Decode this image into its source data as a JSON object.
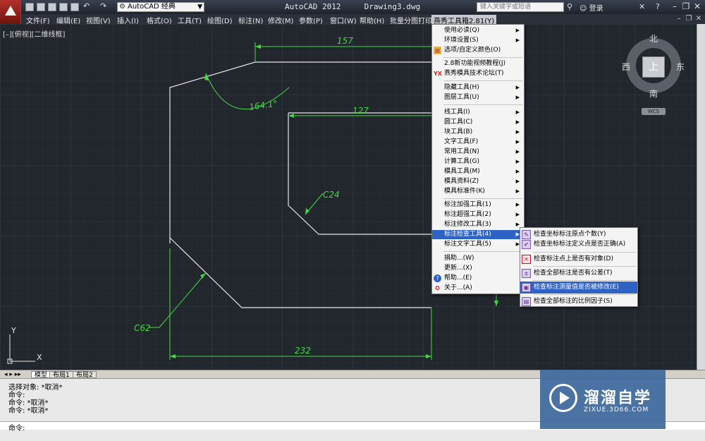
{
  "titlebar": {
    "app_title": "AutoCAD 2012",
    "document": "Drawing3.dwg",
    "workspace": "AutoCAD 经典",
    "search_placeholder": "键入关键字或短语",
    "login": "登录",
    "minimize": "–",
    "restore": "❐",
    "close": "✕"
  },
  "menubar": [
    {
      "label": "文件(F)"
    },
    {
      "label": "编辑(E)"
    },
    {
      "label": "视图(V)"
    },
    {
      "label": "插入(I)"
    },
    {
      "label": "格式(O)"
    },
    {
      "label": "工具(T)"
    },
    {
      "label": "绘图(D)"
    },
    {
      "label": "标注(N)"
    },
    {
      "label": "修改(M)"
    },
    {
      "label": "参数(P)"
    },
    {
      "label": "窗口(W)"
    },
    {
      "label": "帮助(H)"
    },
    {
      "label": "批量分图打印"
    },
    {
      "label": "燕秀工具箱2.81(Y)"
    }
  ],
  "viewport": {
    "label": "[–][俯视][二维线框]"
  },
  "viewcube": {
    "north": "北",
    "south": "南",
    "east": "东",
    "west": "西",
    "top": "上",
    "wcs": "WCS"
  },
  "drawing": {
    "dims": {
      "d157": "157",
      "d127": "127",
      "angle": "164.1°",
      "c24": "C24",
      "c62": "C62",
      "d232": "232"
    },
    "ucs": {
      "x": "X",
      "y": "Y"
    }
  },
  "menu": {
    "items": [
      {
        "label": "使用必读(Q)",
        "arrow": "▶",
        "icon": ""
      },
      {
        "label": "环境设置(S)",
        "arrow": "▶",
        "icon": ""
      },
      {
        "label": "选项/自定义颜色(O)",
        "arrow": "",
        "icon": "▦"
      },
      {
        "label": "2.8新功能视频教程(J)",
        "arrow": "",
        "icon": ""
      },
      {
        "label": "燕秀模具技术论坛(T)",
        "arrow": "",
        "icon": "YX"
      },
      {
        "label": "隐藏工具(H)",
        "arrow": "▶",
        "icon": ""
      },
      {
        "label": "图层工具(U)",
        "arrow": "▶",
        "icon": ""
      },
      {
        "label": "线工具(I)",
        "arrow": "▶",
        "icon": ""
      },
      {
        "label": "圆工具(C)",
        "arrow": "▶",
        "icon": ""
      },
      {
        "label": "块工具(B)",
        "arrow": "▶",
        "icon": ""
      },
      {
        "label": "文字工具(F)",
        "arrow": "▶",
        "icon": ""
      },
      {
        "label": "常用工具(N)",
        "arrow": "▶",
        "icon": ""
      },
      {
        "label": "计算工具(G)",
        "arrow": "▶",
        "icon": ""
      },
      {
        "label": "模具工具(M)",
        "arrow": "▶",
        "icon": ""
      },
      {
        "label": "模具资料(Z)",
        "arrow": "▶",
        "icon": ""
      },
      {
        "label": "模具标准件(K)",
        "arrow": "▶",
        "icon": ""
      },
      {
        "label": "标注加强工具(1)",
        "arrow": "▶",
        "icon": ""
      },
      {
        "label": "标注超强工具(2)",
        "arrow": "▶",
        "icon": ""
      },
      {
        "label": "标注修改工具(3)",
        "arrow": "▶",
        "icon": ""
      },
      {
        "label": "标注检查工具(4)",
        "arrow": "▶",
        "icon": ""
      },
      {
        "label": "标注文字工具(5)",
        "arrow": "▶",
        "icon": ""
      },
      {
        "label": "捐助...(W)",
        "arrow": "",
        "icon": ""
      },
      {
        "label": "更新...(X)",
        "arrow": "",
        "icon": ""
      },
      {
        "label": "帮助...(E)",
        "arrow": "",
        "icon": "?"
      },
      {
        "label": "关于...(A)",
        "arrow": "",
        "icon": "✪"
      }
    ]
  },
  "submenu": {
    "items": [
      {
        "label": "检查坐标标注原点个数(Y)"
      },
      {
        "label": "检查坐标标注定义点是否正确(A)"
      },
      {
        "label": "检查标注点上是否有对象(D)"
      },
      {
        "label": "检查全部标注是否有公差(T)"
      },
      {
        "label": "检查标注测量值是否被修改(E)"
      },
      {
        "label": "检查全部标注的比例因子(S)"
      }
    ]
  },
  "layout_tabs": [
    {
      "label": "模型"
    },
    {
      "label": "布局1"
    },
    {
      "label": "布局2"
    }
  ],
  "command": {
    "lines": [
      "选择对象: *取消*",
      "命令:",
      "命令: *取消*",
      "命令: *取消*"
    ],
    "prompt": "命令:"
  },
  "watermark": {
    "cn": "溜溜自学",
    "en": "ZIXUE.3D66.COM"
  },
  "colors": {
    "dimension": "#43d843",
    "geometry": "#e6e6e6",
    "menu_highlight": "#2e62c5"
  }
}
